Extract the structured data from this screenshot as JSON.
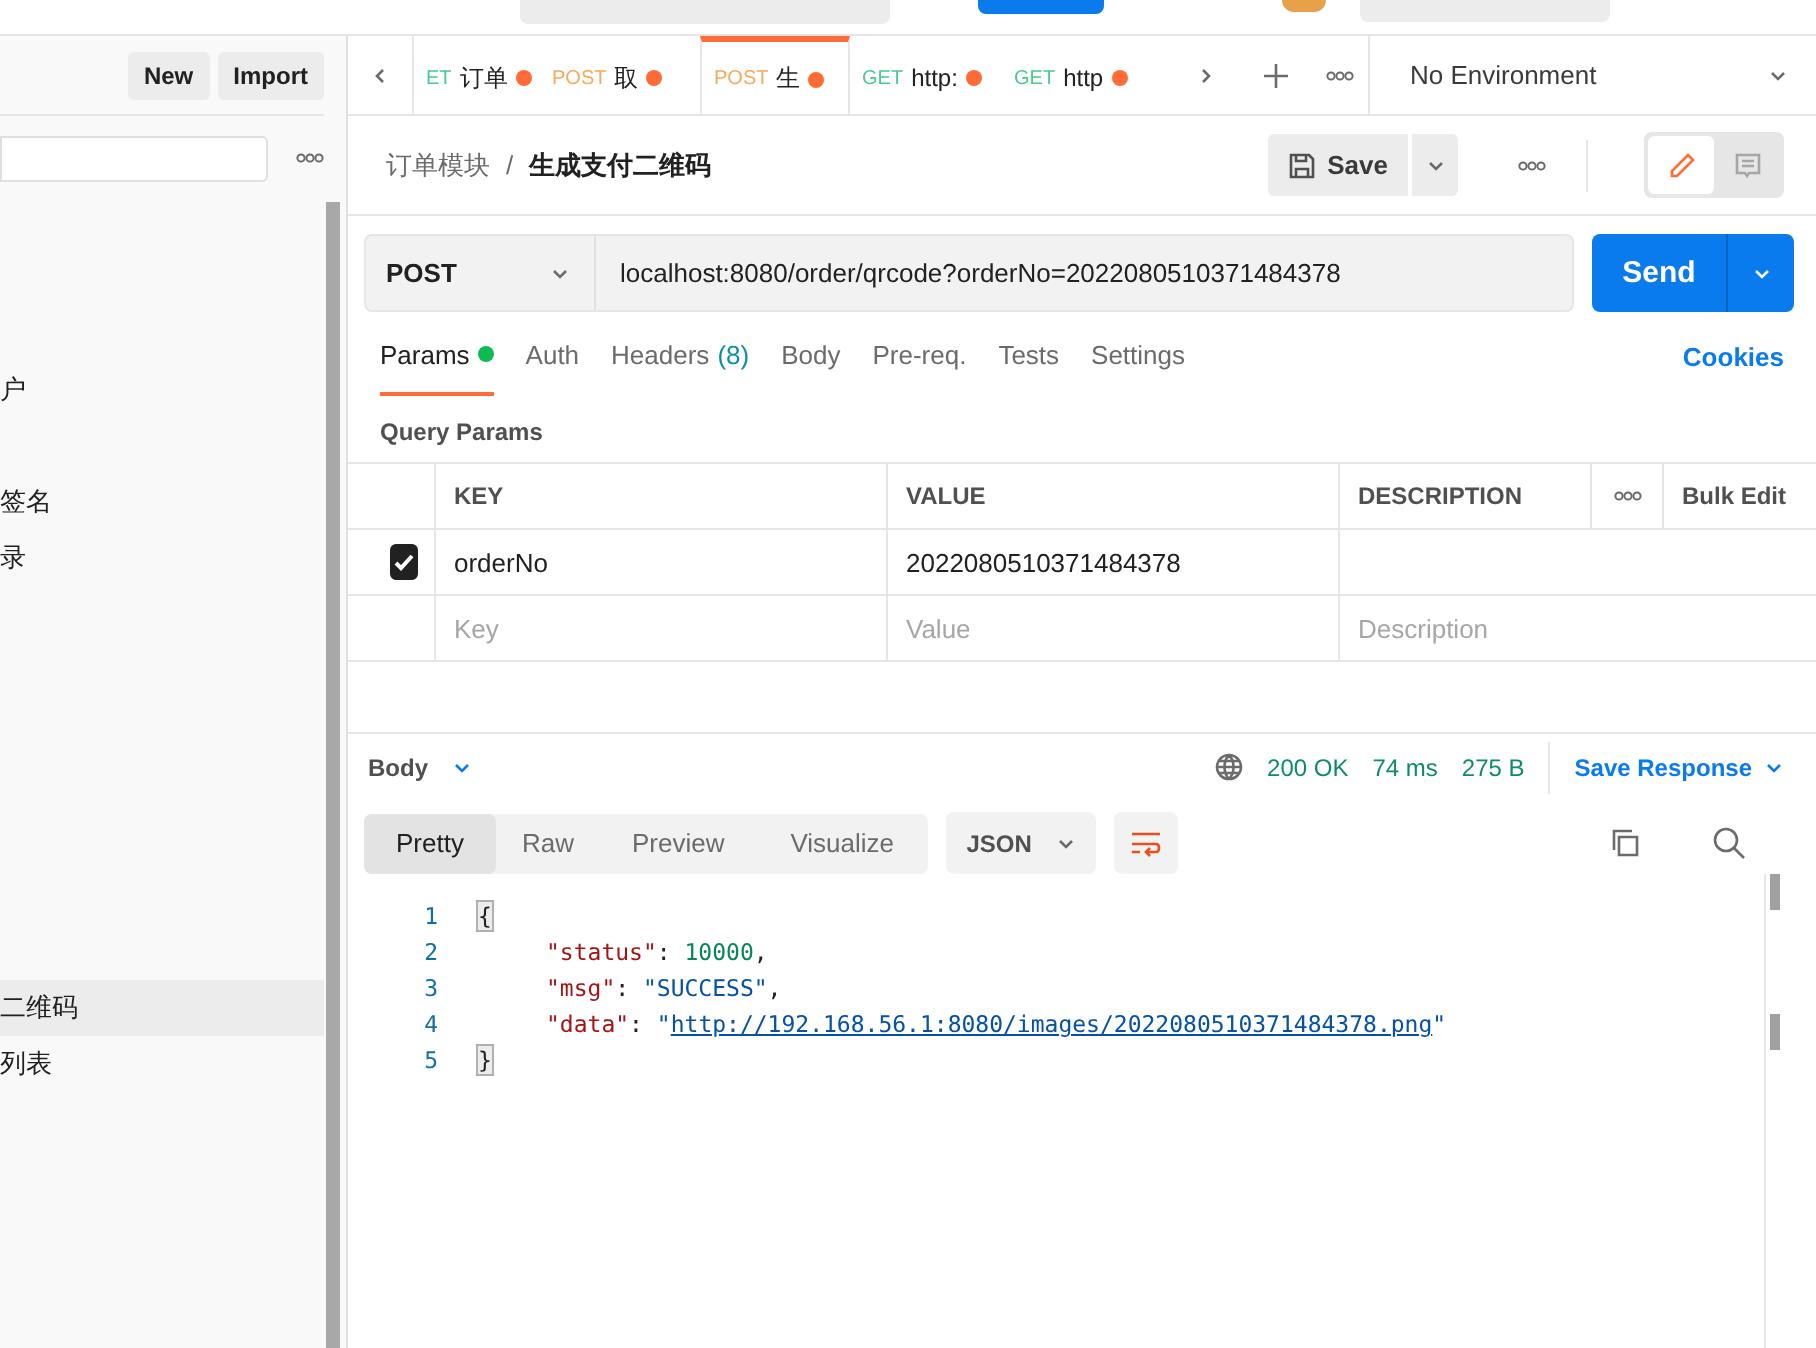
{
  "sidebar": {
    "buttons": [
      "New",
      "Import"
    ],
    "items": [
      {
        "label": "户",
        "selected": false
      },
      {
        "label": "签名",
        "selected": false
      },
      {
        "label": "录",
        "selected": false
      },
      {
        "label": "二维码",
        "selected": true
      },
      {
        "label": "列表",
        "selected": false
      }
    ]
  },
  "tabs": [
    {
      "method": "ET",
      "color": "#49cc90",
      "name": "订单",
      "selected": false
    },
    {
      "method": "POST",
      "color": "#f8a85a",
      "name": "取",
      "selected": false
    },
    {
      "method": "POST",
      "color": "#f8a85a",
      "name": "生",
      "selected": true
    },
    {
      "method": "GET",
      "color": "#49cc90",
      "name": "http:",
      "selected": false
    },
    {
      "method": "GET",
      "color": "#49cc90",
      "name": "http",
      "selected": false
    }
  ],
  "environment": "No Environment",
  "breadcrumb": {
    "parent": "订单模块",
    "separator": "/",
    "current": "生成支付二维码"
  },
  "save_button": "Save",
  "view_toggle": [
    {
      "kind": "edit",
      "selected": true
    },
    {
      "kind": "comment",
      "selected": false
    }
  ],
  "request": {
    "method": "POST",
    "url": "localhost:8080/order/qrcode?orderNo=2022080510371484378",
    "send": "Send"
  },
  "request_tabs": [
    {
      "label": "Params",
      "dot": true,
      "selected": true
    },
    {
      "label": "Auth",
      "dot": false,
      "selected": false
    },
    {
      "label": "Headers",
      "count": "(8)",
      "dot": false,
      "selected": false
    },
    {
      "label": "Body",
      "dot": false,
      "selected": false
    },
    {
      "label": "Pre-req.",
      "dot": false,
      "selected": false
    },
    {
      "label": "Tests",
      "dot": false,
      "selected": false
    },
    {
      "label": "Settings",
      "dot": false,
      "selected": false
    }
  ],
  "cookies": "Cookies",
  "query_params": {
    "title": "Query Params",
    "columns": [
      "KEY",
      "VALUE",
      "DESCRIPTION"
    ],
    "bulk_edit": "Bulk Edit",
    "rows": [
      {
        "checked": true,
        "key": "orderNo",
        "value": "2022080510371484378",
        "description": ""
      }
    ],
    "placeholder": {
      "key": "Key",
      "value": "Value",
      "description": "Description"
    }
  },
  "response": {
    "section": "Body",
    "status": "200 OK",
    "time": "74 ms",
    "size": "275 B",
    "save": "Save Response",
    "views": [
      {
        "label": "Pretty",
        "selected": true
      },
      {
        "label": "Raw",
        "selected": false
      },
      {
        "label": "Preview",
        "selected": false
      },
      {
        "label": "Visualize",
        "selected": false
      }
    ],
    "format": "JSON",
    "lines": [
      {
        "number": "1",
        "indent": false,
        "tokens": [
          {
            "kind": "brace",
            "text": "{"
          }
        ]
      },
      {
        "number": "2",
        "indent": true,
        "tokens": [
          {
            "kind": "key",
            "text": "\"status\""
          },
          {
            "kind": "punct",
            "text": ": "
          },
          {
            "kind": "number",
            "text": "10000"
          },
          {
            "kind": "punct",
            "text": ","
          }
        ]
      },
      {
        "number": "3",
        "indent": true,
        "tokens": [
          {
            "kind": "key",
            "text": "\"msg\""
          },
          {
            "kind": "punct",
            "text": ": "
          },
          {
            "kind": "string",
            "text": "\"SUCCESS\""
          },
          {
            "kind": "punct",
            "text": ","
          }
        ]
      },
      {
        "number": "4",
        "indent": true,
        "tokens": [
          {
            "kind": "key",
            "text": "\"data\""
          },
          {
            "kind": "punct",
            "text": ": "
          },
          {
            "kind": "string",
            "text": "\""
          },
          {
            "kind": "link",
            "text": "http://192.168.56.1:8080/images/2022080510371484378.png"
          },
          {
            "kind": "string",
            "text": "\""
          }
        ]
      },
      {
        "number": "5",
        "indent": false,
        "tokens": [
          {
            "kind": "brace",
            "text": "}"
          }
        ]
      }
    ]
  }
}
